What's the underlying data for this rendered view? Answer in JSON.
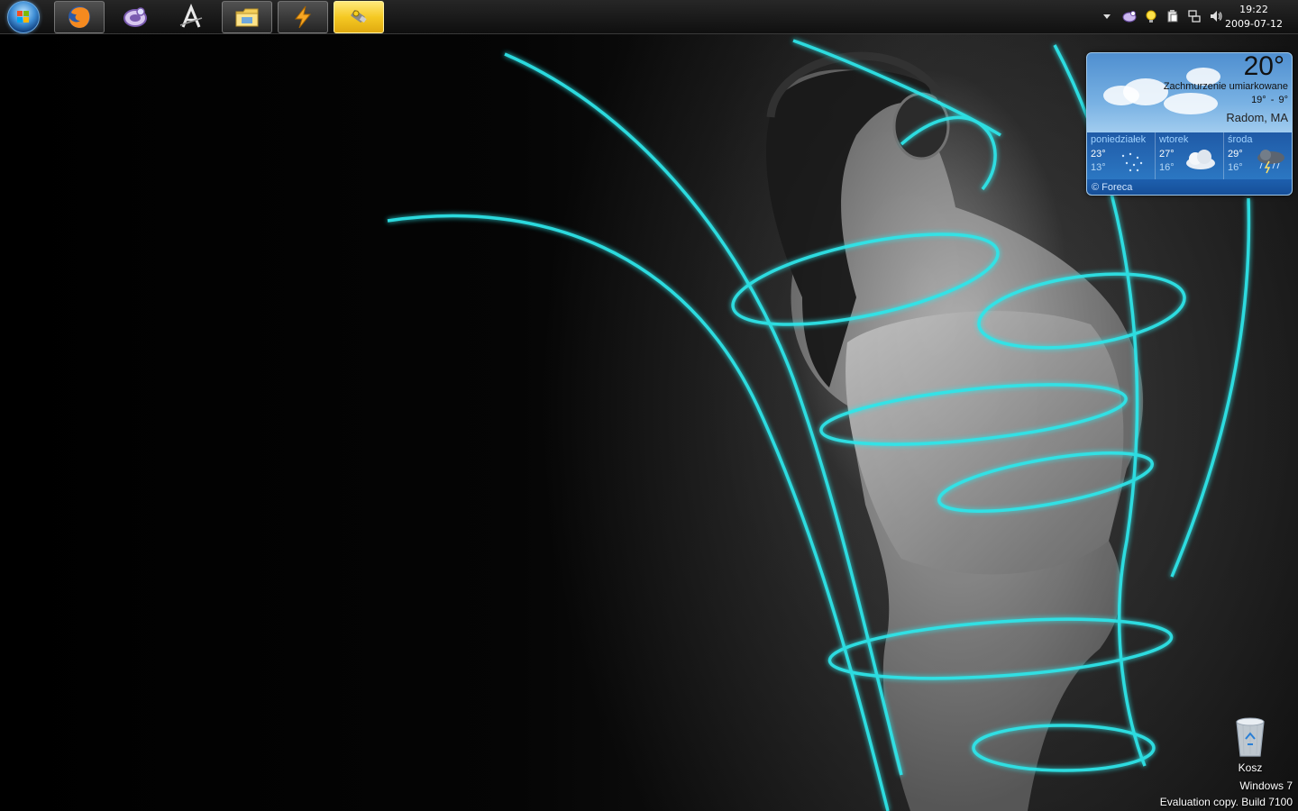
{
  "taskbar": {
    "start": {
      "icon": "windows-orb-icon"
    },
    "items": [
      {
        "name": "firefox",
        "icon": "firefox-icon",
        "state": "active"
      },
      {
        "name": "messenger",
        "icon": "gadu-gadu-icon",
        "state": "pinned"
      },
      {
        "name": "winamp-like",
        "icon": "letter-a-icon",
        "state": "pinned"
      },
      {
        "name": "explorer",
        "icon": "folder-icon",
        "state": "active"
      },
      {
        "name": "winamp",
        "icon": "lightning-icon",
        "state": "active"
      },
      {
        "name": "usb",
        "icon": "usb-key-icon",
        "state": "highlighted"
      }
    ],
    "tray": {
      "icons": [
        "show-hidden-icon",
        "gadu-gadu-tray-icon",
        "status-bulb-icon",
        "clipboard-icon",
        "network-icon",
        "volume-icon"
      ]
    },
    "clock": {
      "time": "19:22",
      "date": "2009-07-12"
    }
  },
  "weather": {
    "temp": "20°",
    "condition": "Zachmurzenie umiarkowane",
    "range": "19° - 9°",
    "location": "Radom, MA",
    "forecast": [
      {
        "day": "poniedziałek",
        "high": "23°",
        "low": "13°",
        "icon": "rain-icon"
      },
      {
        "day": "wtorek",
        "high": "27°",
        "low": "16°",
        "icon": "cloudy-icon"
      },
      {
        "day": "środa",
        "high": "29°",
        "low": "16°",
        "icon": "storm-icon"
      }
    ],
    "credit": "© Foreca"
  },
  "desktop": {
    "recycle_bin": {
      "label": "Kosz",
      "icon": "recycle-bin-icon"
    },
    "watermark": {
      "line1": "Windows 7",
      "line2": "Evaluation copy. Build 7100"
    }
  },
  "colors": {
    "accent_cyan": "#2de6ea",
    "taskbar": "#1a1a1a",
    "highlight": "#f5c923",
    "weather_panel": "#78b1e3"
  }
}
